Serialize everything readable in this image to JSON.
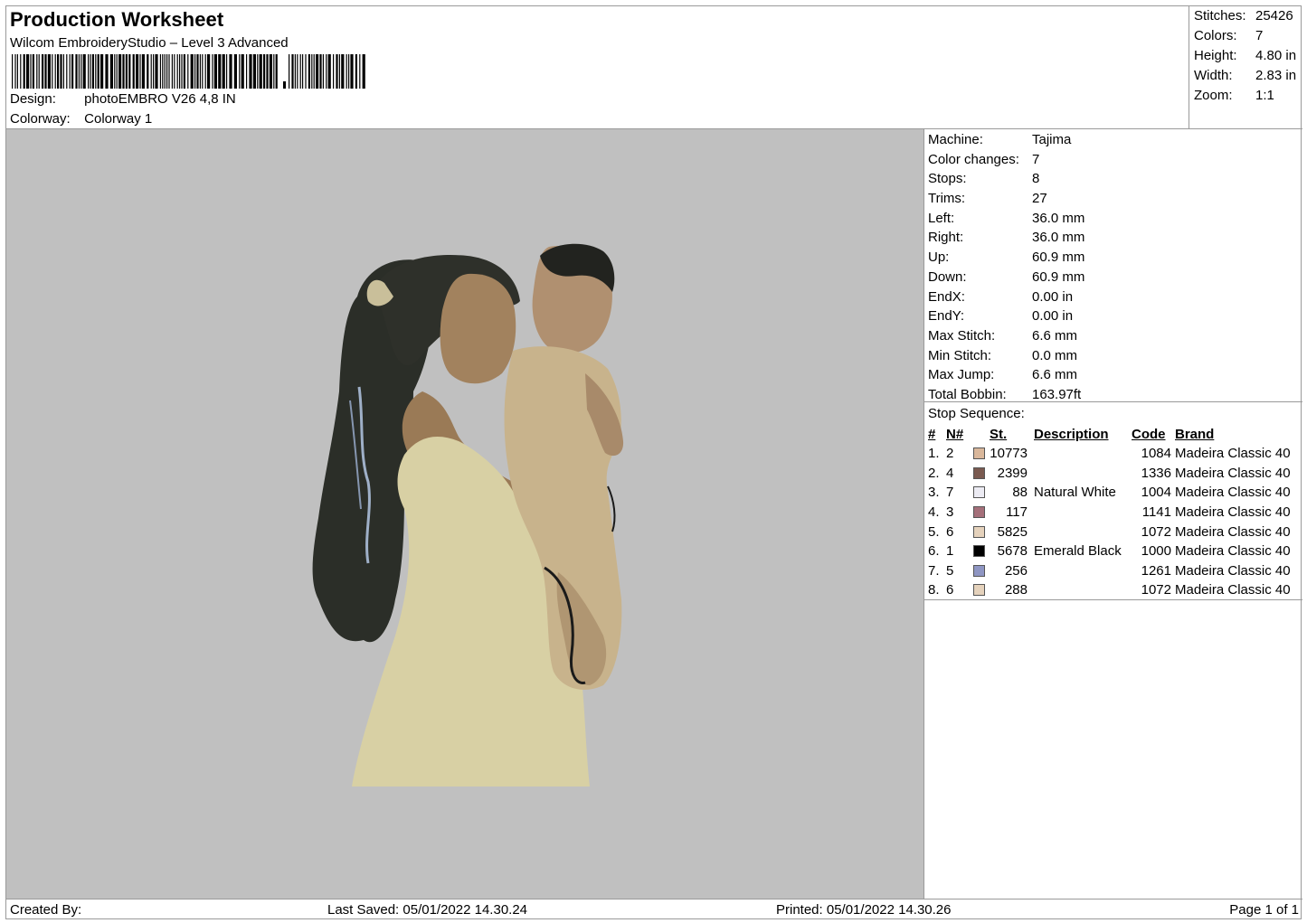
{
  "header": {
    "title": "Production Worksheet",
    "software": "Wilcom EmbroideryStudio – Level 3 Advanced",
    "design_label": "Design:",
    "design_value": "photoEMBRO V26 4,8 IN",
    "colorway_label": "Colorway:",
    "colorway_value": "Colorway 1"
  },
  "summary": [
    {
      "label": "Stitches:",
      "value": "25426"
    },
    {
      "label": "Colors:",
      "value": "7"
    },
    {
      "label": "Height:",
      "value": "4.80 in"
    },
    {
      "label": "Width:",
      "value": "2.83 in"
    },
    {
      "label": "Zoom:",
      "value": "1:1"
    }
  ],
  "machine_info": [
    {
      "label": "Machine:",
      "value": "Tajima"
    },
    {
      "label": "Color changes:",
      "value": "7"
    },
    {
      "label": "Stops:",
      "value": "8"
    },
    {
      "label": "Trims:",
      "value": "27"
    },
    {
      "label": "Left:",
      "value": "36.0 mm"
    },
    {
      "label": "Right:",
      "value": "36.0 mm"
    },
    {
      "label": "Up:",
      "value": "60.9 mm"
    },
    {
      "label": "Down:",
      "value": "60.9 mm"
    },
    {
      "label": "EndX:",
      "value": "0.00 in"
    },
    {
      "label": "EndY:",
      "value": "0.00 in"
    },
    {
      "label": "Max Stitch:",
      "value": "6.6 mm"
    },
    {
      "label": "Min Stitch:",
      "value": "0.0 mm"
    },
    {
      "label": "Max Jump:",
      "value": "6.6 mm"
    },
    {
      "label": "Total Bobbin:",
      "value": "163.97ft"
    }
  ],
  "stop_sequence": {
    "title": "Stop Sequence:",
    "headers": {
      "num": "#",
      "n": "N#",
      "st": "St.",
      "desc": "Description",
      "code": "Code",
      "brand": "Brand"
    },
    "rows": [
      {
        "num": "1.",
        "n": "2",
        "color": "#d9b79b",
        "st": "10773",
        "desc": "",
        "code": "1084",
        "brand": "Madeira Classic 40"
      },
      {
        "num": "2.",
        "n": "4",
        "color": "#7a5a50",
        "st": "2399",
        "desc": "",
        "code": "1336",
        "brand": "Madeira Classic 40"
      },
      {
        "num": "3.",
        "n": "7",
        "color": "#ecebf3",
        "st": "88",
        "desc": "Natural White",
        "code": "1004",
        "brand": "Madeira Classic 40"
      },
      {
        "num": "4.",
        "n": "3",
        "color": "#a5707a",
        "st": "117",
        "desc": "",
        "code": "1141",
        "brand": "Madeira Classic 40"
      },
      {
        "num": "5.",
        "n": "6",
        "color": "#e5d2bc",
        "st": "5825",
        "desc": "",
        "code": "1072",
        "brand": "Madeira Classic 40"
      },
      {
        "num": "6.",
        "n": "1",
        "color": "#000000",
        "st": "5678",
        "desc": "Emerald Black",
        "code": "1000",
        "brand": "Madeira Classic 40"
      },
      {
        "num": "7.",
        "n": "5",
        "color": "#8f96c3",
        "st": "256",
        "desc": "",
        "code": "1261",
        "brand": "Madeira Classic 40"
      },
      {
        "num": "8.",
        "n": "6",
        "color": "#e5d2bc",
        "st": "288",
        "desc": "",
        "code": "1072",
        "brand": "Madeira Classic 40"
      }
    ]
  },
  "footer": {
    "created_by": "Created By:",
    "last_saved": "Last Saved: 05/01/2022 14.30.24",
    "printed": "Printed: 05/01/2022 14.30.26",
    "page": "Page 1 of 1"
  },
  "preview": {
    "background": "#c0c0c0",
    "hair_color": "#2b2e28",
    "dress_color": "#d8d0a4",
    "skin_color": "#a88a6a",
    "baby_skin_color": "#b8a07c"
  }
}
